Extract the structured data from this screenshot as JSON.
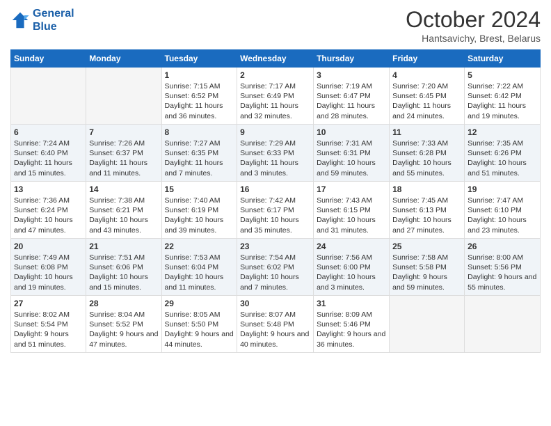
{
  "header": {
    "logo_line1": "General",
    "logo_line2": "Blue",
    "month": "October 2024",
    "location": "Hantsavichy, Brest, Belarus"
  },
  "days_of_week": [
    "Sunday",
    "Monday",
    "Tuesday",
    "Wednesday",
    "Thursday",
    "Friday",
    "Saturday"
  ],
  "weeks": [
    [
      {
        "day": "",
        "sunrise": "",
        "sunset": "",
        "daylight": ""
      },
      {
        "day": "",
        "sunrise": "",
        "sunset": "",
        "daylight": ""
      },
      {
        "day": "1",
        "sunrise": "Sunrise: 7:15 AM",
        "sunset": "Sunset: 6:52 PM",
        "daylight": "Daylight: 11 hours and 36 minutes."
      },
      {
        "day": "2",
        "sunrise": "Sunrise: 7:17 AM",
        "sunset": "Sunset: 6:49 PM",
        "daylight": "Daylight: 11 hours and 32 minutes."
      },
      {
        "day": "3",
        "sunrise": "Sunrise: 7:19 AM",
        "sunset": "Sunset: 6:47 PM",
        "daylight": "Daylight: 11 hours and 28 minutes."
      },
      {
        "day": "4",
        "sunrise": "Sunrise: 7:20 AM",
        "sunset": "Sunset: 6:45 PM",
        "daylight": "Daylight: 11 hours and 24 minutes."
      },
      {
        "day": "5",
        "sunrise": "Sunrise: 7:22 AM",
        "sunset": "Sunset: 6:42 PM",
        "daylight": "Daylight: 11 hours and 19 minutes."
      }
    ],
    [
      {
        "day": "6",
        "sunrise": "Sunrise: 7:24 AM",
        "sunset": "Sunset: 6:40 PM",
        "daylight": "Daylight: 11 hours and 15 minutes."
      },
      {
        "day": "7",
        "sunrise": "Sunrise: 7:26 AM",
        "sunset": "Sunset: 6:37 PM",
        "daylight": "Daylight: 11 hours and 11 minutes."
      },
      {
        "day": "8",
        "sunrise": "Sunrise: 7:27 AM",
        "sunset": "Sunset: 6:35 PM",
        "daylight": "Daylight: 11 hours and 7 minutes."
      },
      {
        "day": "9",
        "sunrise": "Sunrise: 7:29 AM",
        "sunset": "Sunset: 6:33 PM",
        "daylight": "Daylight: 11 hours and 3 minutes."
      },
      {
        "day": "10",
        "sunrise": "Sunrise: 7:31 AM",
        "sunset": "Sunset: 6:31 PM",
        "daylight": "Daylight: 10 hours and 59 minutes."
      },
      {
        "day": "11",
        "sunrise": "Sunrise: 7:33 AM",
        "sunset": "Sunset: 6:28 PM",
        "daylight": "Daylight: 10 hours and 55 minutes."
      },
      {
        "day": "12",
        "sunrise": "Sunrise: 7:35 AM",
        "sunset": "Sunset: 6:26 PM",
        "daylight": "Daylight: 10 hours and 51 minutes."
      }
    ],
    [
      {
        "day": "13",
        "sunrise": "Sunrise: 7:36 AM",
        "sunset": "Sunset: 6:24 PM",
        "daylight": "Daylight: 10 hours and 47 minutes."
      },
      {
        "day": "14",
        "sunrise": "Sunrise: 7:38 AM",
        "sunset": "Sunset: 6:21 PM",
        "daylight": "Daylight: 10 hours and 43 minutes."
      },
      {
        "day": "15",
        "sunrise": "Sunrise: 7:40 AM",
        "sunset": "Sunset: 6:19 PM",
        "daylight": "Daylight: 10 hours and 39 minutes."
      },
      {
        "day": "16",
        "sunrise": "Sunrise: 7:42 AM",
        "sunset": "Sunset: 6:17 PM",
        "daylight": "Daylight: 10 hours and 35 minutes."
      },
      {
        "day": "17",
        "sunrise": "Sunrise: 7:43 AM",
        "sunset": "Sunset: 6:15 PM",
        "daylight": "Daylight: 10 hours and 31 minutes."
      },
      {
        "day": "18",
        "sunrise": "Sunrise: 7:45 AM",
        "sunset": "Sunset: 6:13 PM",
        "daylight": "Daylight: 10 hours and 27 minutes."
      },
      {
        "day": "19",
        "sunrise": "Sunrise: 7:47 AM",
        "sunset": "Sunset: 6:10 PM",
        "daylight": "Daylight: 10 hours and 23 minutes."
      }
    ],
    [
      {
        "day": "20",
        "sunrise": "Sunrise: 7:49 AM",
        "sunset": "Sunset: 6:08 PM",
        "daylight": "Daylight: 10 hours and 19 minutes."
      },
      {
        "day": "21",
        "sunrise": "Sunrise: 7:51 AM",
        "sunset": "Sunset: 6:06 PM",
        "daylight": "Daylight: 10 hours and 15 minutes."
      },
      {
        "day": "22",
        "sunrise": "Sunrise: 7:53 AM",
        "sunset": "Sunset: 6:04 PM",
        "daylight": "Daylight: 10 hours and 11 minutes."
      },
      {
        "day": "23",
        "sunrise": "Sunrise: 7:54 AM",
        "sunset": "Sunset: 6:02 PM",
        "daylight": "Daylight: 10 hours and 7 minutes."
      },
      {
        "day": "24",
        "sunrise": "Sunrise: 7:56 AM",
        "sunset": "Sunset: 6:00 PM",
        "daylight": "Daylight: 10 hours and 3 minutes."
      },
      {
        "day": "25",
        "sunrise": "Sunrise: 7:58 AM",
        "sunset": "Sunset: 5:58 PM",
        "daylight": "Daylight: 9 hours and 59 minutes."
      },
      {
        "day": "26",
        "sunrise": "Sunrise: 8:00 AM",
        "sunset": "Sunset: 5:56 PM",
        "daylight": "Daylight: 9 hours and 55 minutes."
      }
    ],
    [
      {
        "day": "27",
        "sunrise": "Sunrise: 8:02 AM",
        "sunset": "Sunset: 5:54 PM",
        "daylight": "Daylight: 9 hours and 51 minutes."
      },
      {
        "day": "28",
        "sunrise": "Sunrise: 8:04 AM",
        "sunset": "Sunset: 5:52 PM",
        "daylight": "Daylight: 9 hours and 47 minutes."
      },
      {
        "day": "29",
        "sunrise": "Sunrise: 8:05 AM",
        "sunset": "Sunset: 5:50 PM",
        "daylight": "Daylight: 9 hours and 44 minutes."
      },
      {
        "day": "30",
        "sunrise": "Sunrise: 8:07 AM",
        "sunset": "Sunset: 5:48 PM",
        "daylight": "Daylight: 9 hours and 40 minutes."
      },
      {
        "day": "31",
        "sunrise": "Sunrise: 8:09 AM",
        "sunset": "Sunset: 5:46 PM",
        "daylight": "Daylight: 9 hours and 36 minutes."
      },
      {
        "day": "",
        "sunrise": "",
        "sunset": "",
        "daylight": ""
      },
      {
        "day": "",
        "sunrise": "",
        "sunset": "",
        "daylight": ""
      }
    ]
  ]
}
